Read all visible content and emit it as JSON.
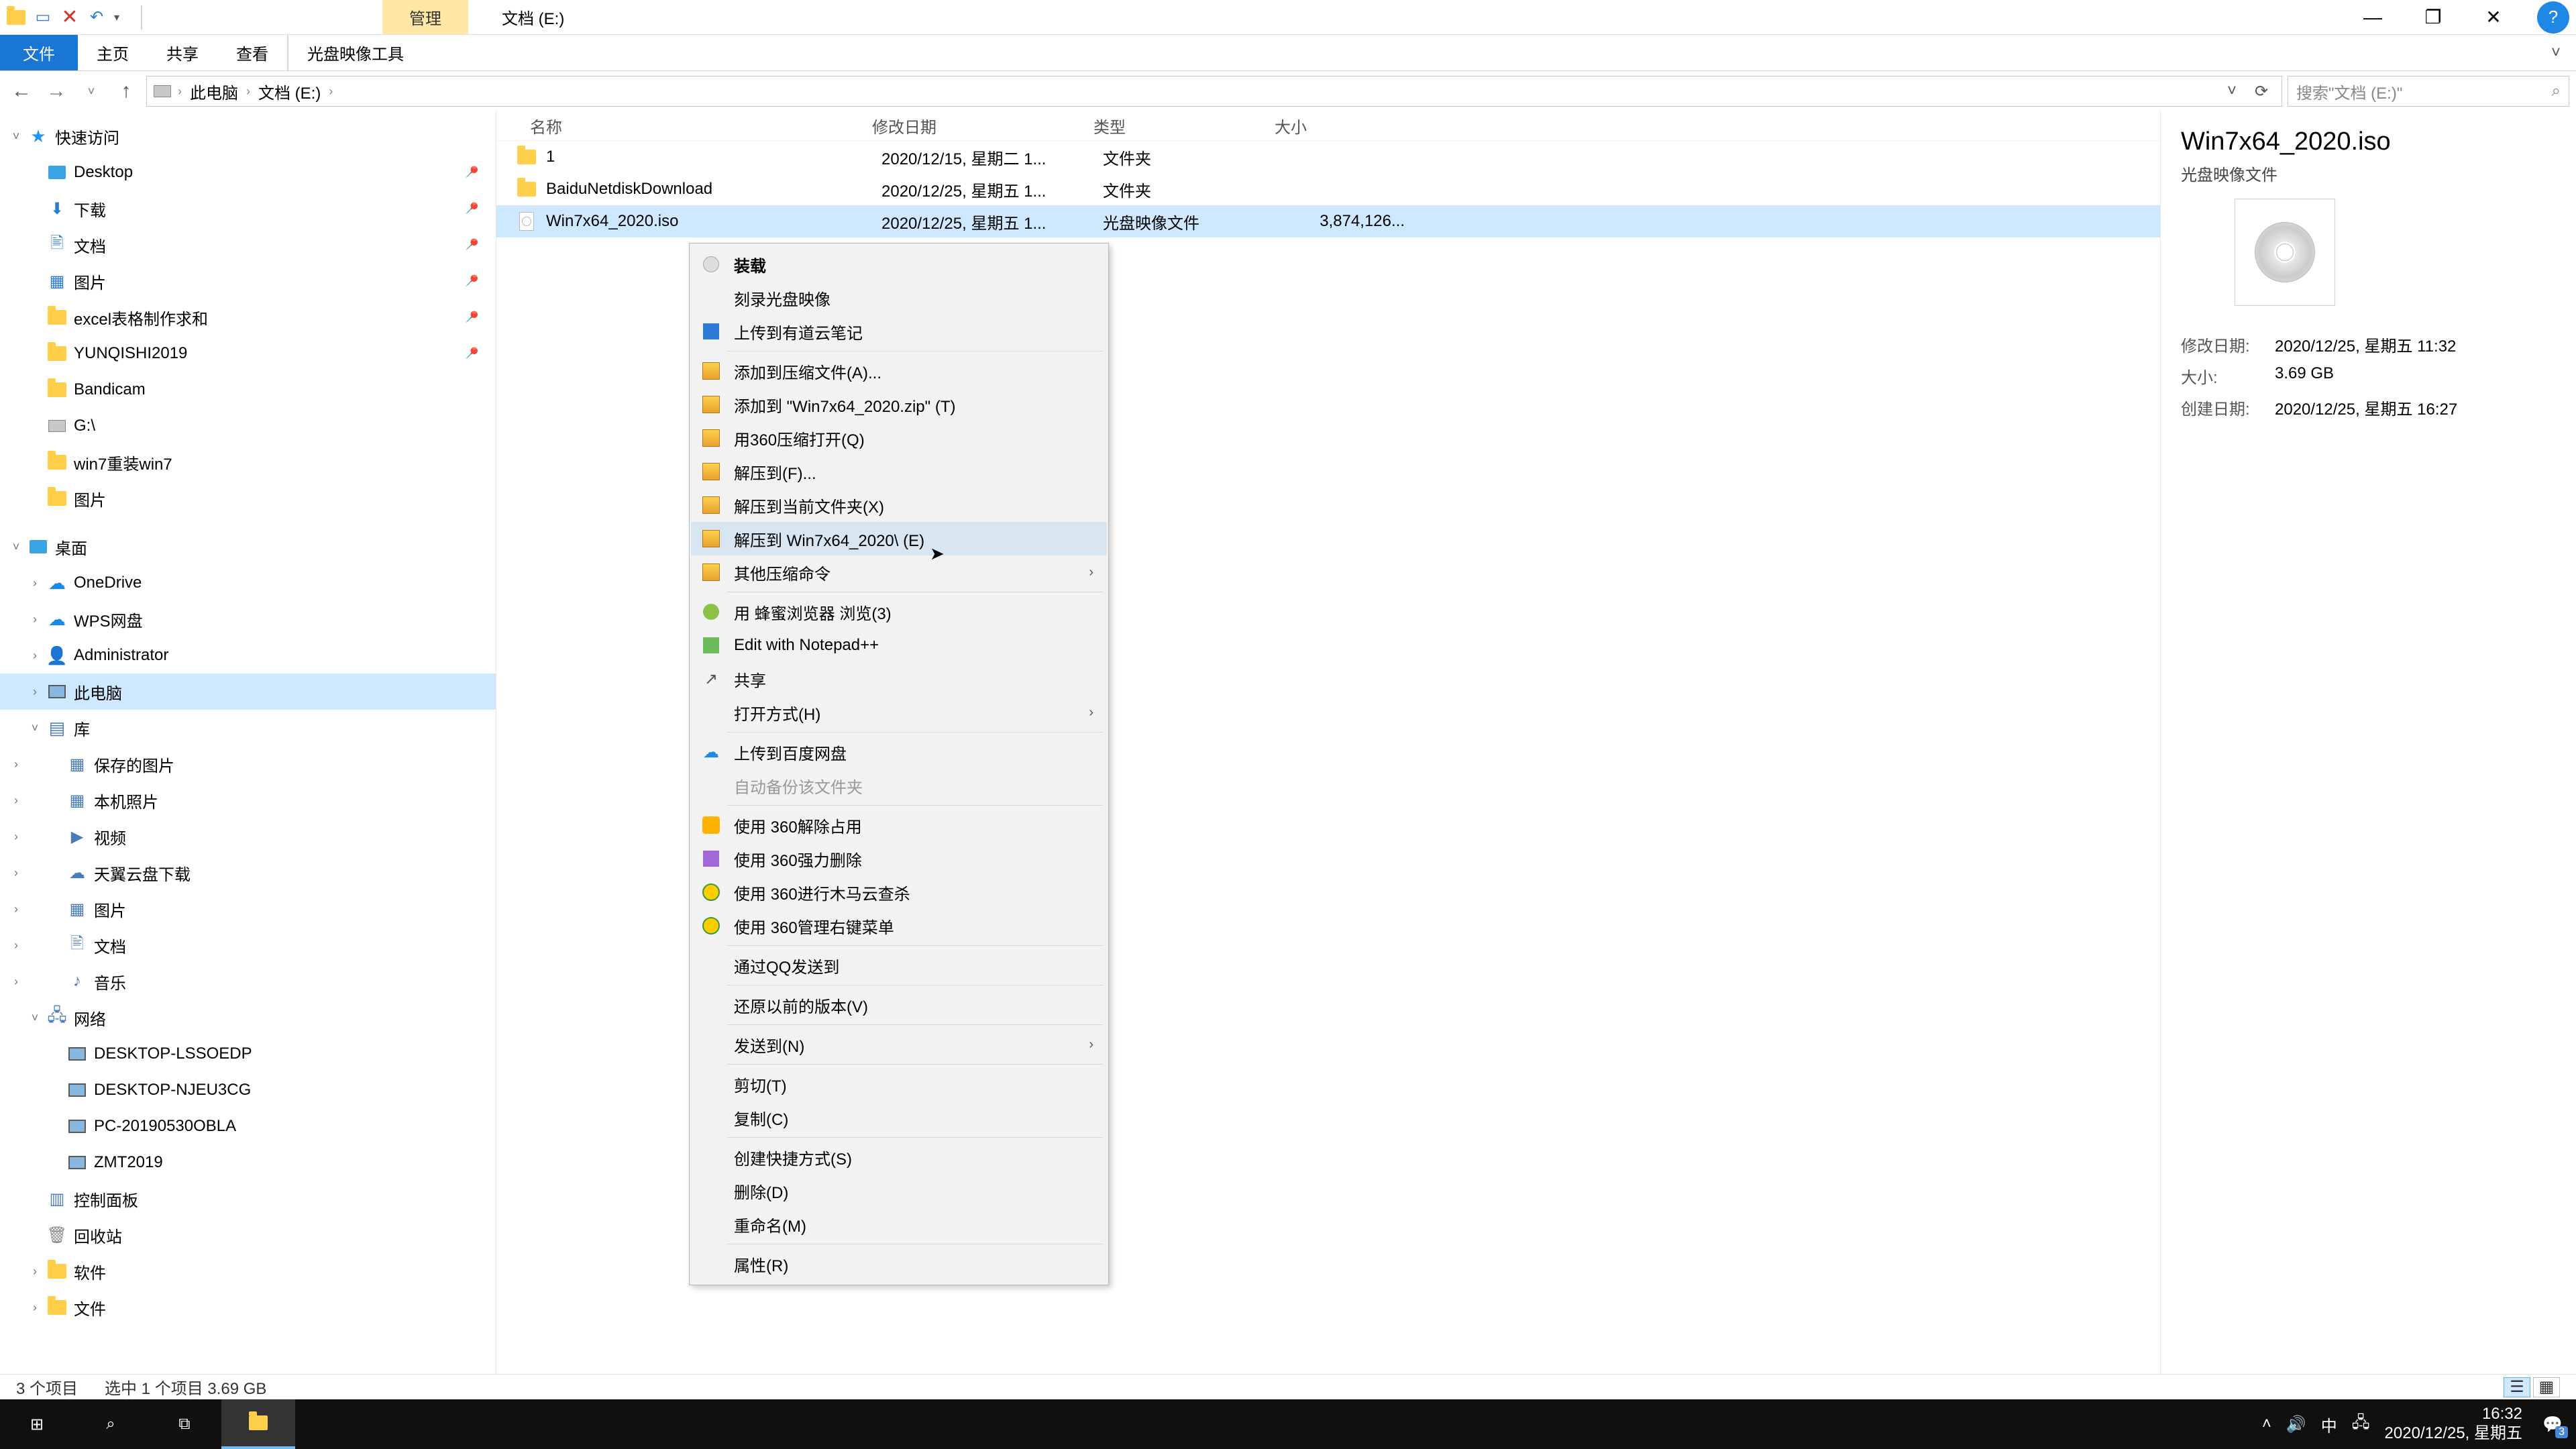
{
  "titlebar": {
    "context_tab": "管理",
    "title": "文档 (E:)"
  },
  "wincontrols": {
    "min": "—",
    "max": "❐",
    "close": "✕",
    "help": "?"
  },
  "ribbon": {
    "file": "文件",
    "tabs": [
      "主页",
      "共享",
      "查看"
    ],
    "context": "光盘映像工具"
  },
  "nav": {
    "back": "←",
    "forward": "→",
    "up": "↑",
    "dropdown": "˅",
    "refresh": "⟳"
  },
  "address": {
    "crumbs": [
      "此电脑",
      "文档 (E:)"
    ],
    "sep": "›"
  },
  "search": {
    "placeholder": "搜索\"文档 (E:)\"",
    "icon": "⌕"
  },
  "nav_pane": {
    "quick_access": "快速访问",
    "quick_items": [
      {
        "label": "Desktop",
        "pin": true
      },
      {
        "label": "下载",
        "pin": true
      },
      {
        "label": "文档",
        "pin": true
      },
      {
        "label": "图片",
        "pin": true
      },
      {
        "label": "excel表格制作求和",
        "pin": true
      },
      {
        "label": "YUNQISHI2019",
        "pin": true
      },
      {
        "label": "Bandicam"
      },
      {
        "label": "G:\\"
      },
      {
        "label": "win7重装win7"
      },
      {
        "label": "图片"
      }
    ],
    "desktop": "桌面",
    "desktop_items": [
      "OneDrive",
      "WPS网盘",
      "Administrator"
    ],
    "this_pc": "此电脑",
    "libraries": "库",
    "lib_items": [
      "保存的图片",
      "本机照片",
      "视频",
      "天翼云盘下载",
      "图片",
      "文档",
      "音乐"
    ],
    "network": "网络",
    "net_items": [
      "DESKTOP-LSSOEDP",
      "DESKTOP-NJEU3CG",
      "PC-20190530OBLA",
      "ZMT2019"
    ],
    "others": [
      "控制面板",
      "回收站",
      "软件",
      "文件"
    ]
  },
  "columns": {
    "name": "名称",
    "date": "修改日期",
    "type": "类型",
    "size": "大小"
  },
  "rows": [
    {
      "name": "1",
      "date": "2020/12/15, 星期二 1...",
      "type": "文件夹",
      "size": "",
      "kind": "folder"
    },
    {
      "name": "BaiduNetdiskDownload",
      "date": "2020/12/25, 星期五 1...",
      "type": "文件夹",
      "size": "",
      "kind": "folder"
    },
    {
      "name": "Win7x64_2020.iso",
      "date": "2020/12/25, 星期五 1...",
      "type": "光盘映像文件",
      "size": "3,874,126...",
      "kind": "iso",
      "selected": true
    }
  ],
  "details": {
    "title": "Win7x64_2020.iso",
    "type": "光盘映像文件",
    "props": [
      {
        "label": "修改日期:",
        "value": "2020/12/25, 星期五 11:32"
      },
      {
        "label": "大小:",
        "value": "3.69 GB"
      },
      {
        "label": "创建日期:",
        "value": "2020/12/25, 星期五 16:27"
      }
    ]
  },
  "context_menu": [
    {
      "label": "装载",
      "icon": "disc",
      "bold": true
    },
    {
      "label": "刻录光盘映像"
    },
    {
      "label": "上传到有道云笔记",
      "icon": "note"
    },
    {
      "sep": true
    },
    {
      "label": "添加到压缩文件(A)...",
      "icon": "zip"
    },
    {
      "label": "添加到 \"Win7x64_2020.zip\" (T)",
      "icon": "zip"
    },
    {
      "label": "用360压缩打开(Q)",
      "icon": "zip"
    },
    {
      "label": "解压到(F)...",
      "icon": "zip"
    },
    {
      "label": "解压到当前文件夹(X)",
      "icon": "zip"
    },
    {
      "label": "解压到 Win7x64_2020\\ (E)",
      "icon": "zip",
      "hover": true
    },
    {
      "label": "其他压缩命令",
      "icon": "zip",
      "submenu": true
    },
    {
      "sep": true
    },
    {
      "label": "用 蜂蜜浏览器 浏览(3)",
      "icon": "bee"
    },
    {
      "label": "Edit with Notepad++",
      "icon": "np"
    },
    {
      "label": "共享",
      "icon": "share"
    },
    {
      "label": "打开方式(H)",
      "submenu": true
    },
    {
      "sep": true
    },
    {
      "label": "上传到百度网盘",
      "icon": "cloud"
    },
    {
      "label": "自动备份该文件夹",
      "disabled": true
    },
    {
      "sep": true
    },
    {
      "label": "使用 360解除占用",
      "icon": "360y"
    },
    {
      "label": "使用 360强力删除",
      "icon": "trash"
    },
    {
      "label": "使用 360进行木马云查杀",
      "icon": "360"
    },
    {
      "label": "使用 360管理右键菜单",
      "icon": "360"
    },
    {
      "sep": true
    },
    {
      "label": "通过QQ发送到"
    },
    {
      "sep": true
    },
    {
      "label": "还原以前的版本(V)"
    },
    {
      "sep": true
    },
    {
      "label": "发送到(N)",
      "submenu": true
    },
    {
      "sep": true
    },
    {
      "label": "剪切(T)"
    },
    {
      "label": "复制(C)"
    },
    {
      "sep": true
    },
    {
      "label": "创建快捷方式(S)"
    },
    {
      "label": "删除(D)"
    },
    {
      "label": "重命名(M)"
    },
    {
      "sep": true
    },
    {
      "label": "属性(R)"
    }
  ],
  "statusbar": {
    "count": "3 个项目",
    "selection": "选中 1 个项目  3.69 GB"
  },
  "taskbar": {
    "ime": "中",
    "time": "16:32",
    "date": "2020/12/25, 星期五",
    "badge": "3"
  }
}
